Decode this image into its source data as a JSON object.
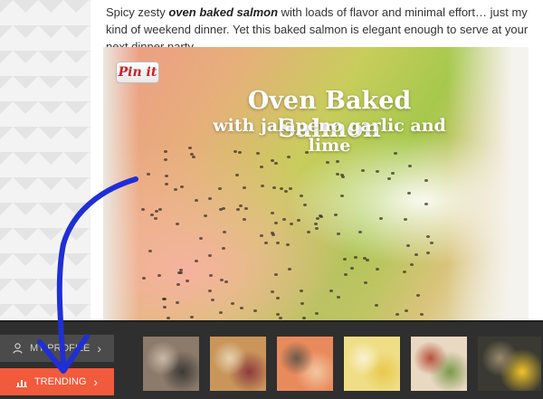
{
  "article": {
    "intro_before": "Spicy zesty ",
    "intro_bold": "oven baked salmon",
    "intro_after": " with loads of flavor and minimal effort… just my kind of weekend dinner. Yet this baked salmon is elegant enough to serve at your next dinner party."
  },
  "hero": {
    "title": "Oven Baked Salmon",
    "subtitle": "with jalapeno garlic and lime",
    "pin_label": "Pin it"
  },
  "bottom_bar": {
    "profile_label": "MY PROFILE",
    "trending_label": "TRENDING",
    "chevron": "›",
    "accent_color": "#f25a3c",
    "thumbnails": [
      {
        "name": "two-women-photo",
        "colors": [
          "#8c7a6a",
          "#3c3a36",
          "#c8b8a6"
        ]
      },
      {
        "name": "berry-bread-photo",
        "colors": [
          "#c9955a",
          "#8d3b3e",
          "#e6d2b0"
        ]
      },
      {
        "name": "shrimp-platter-photo",
        "colors": [
          "#e98a5c",
          "#f3c7a2",
          "#6a5a4a"
        ]
      },
      {
        "name": "yellow-cookies-photo",
        "colors": [
          "#f0de86",
          "#e9c84e",
          "#f8f1cf"
        ]
      },
      {
        "name": "tacos-plate-photo",
        "colors": [
          "#e9d8c2",
          "#7a9a4a",
          "#b6503a"
        ]
      },
      {
        "name": "grilled-food-photo",
        "colors": [
          "#3a3a32",
          "#f0c42a",
          "#9a8a6a"
        ]
      }
    ]
  }
}
